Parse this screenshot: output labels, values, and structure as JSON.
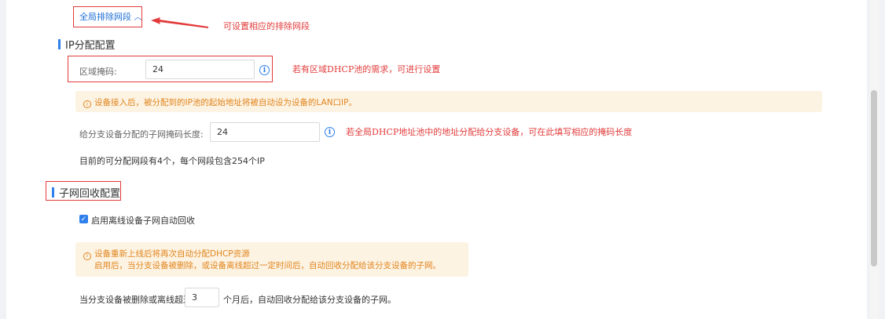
{
  "exclude_segment": {
    "toggle_label": "全局排除网段",
    "annotation": "可设置相应的排除网段"
  },
  "ip_alloc": {
    "title": "IP分配配置",
    "area_mask_label": "区域掩码:",
    "area_mask_value": "24",
    "area_mask_note": "若有区域DHCP池的需求，可进行设置",
    "warning": "设备接入后，被分配到的IP池的起始地址将被自动设为设备的LAN口IP。",
    "branch_mask_label": "给分支设备分配的子网掩码长度:",
    "branch_mask_value": "24",
    "branch_mask_note": "若全局DHCP地址池中的地址分配给分支设备，可在此填写相应的掩码长度",
    "summary": "目前的可分配网段有4个，每个网段包含254个IP"
  },
  "subnet_recycle": {
    "title": "子网回收配置",
    "checkbox_label": "启用离线设备子网自动回收",
    "checkbox_checked": true,
    "warning_line1": "设备重新上线后将再次自动分配DHCP资源",
    "warning_line2": "启用后，当分支设备被删除，或设备离线超过一定时间后，自动回收分配给该分支设备的子网。",
    "months_prefix": "当分支设备被删除或离线超过",
    "months_value": "3",
    "months_suffix": "个月后，自动回收分配给该分支设备的子网。"
  },
  "colors": {
    "accent": "#2f80ed",
    "annotation_red": "#e23b3b",
    "warning_orange": "#e0851d",
    "warning_bg": "#fdf3e3"
  }
}
